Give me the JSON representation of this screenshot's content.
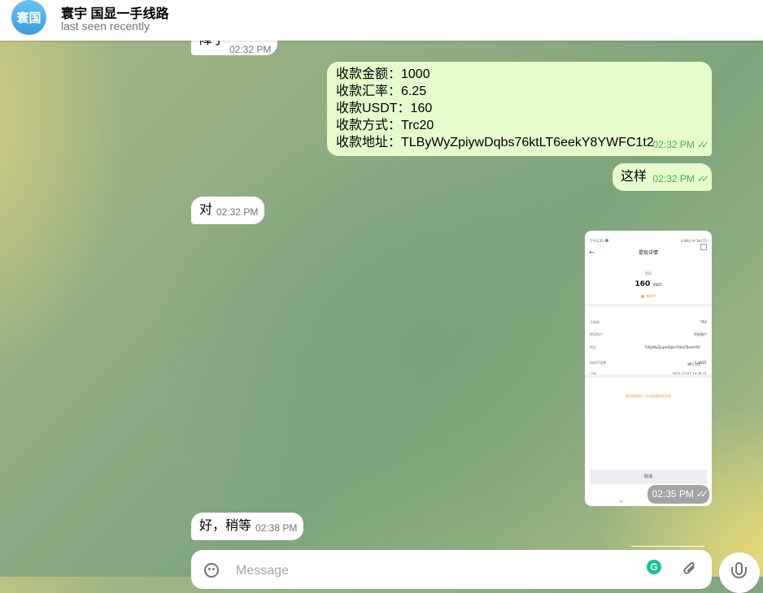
{
  "header": {
    "avatar_text": "寰国",
    "title": "寰宇 国显一手线路",
    "subtitle": "last seen recently"
  },
  "messages": {
    "top_partial": {
      "text": "障了",
      "time": "02:32 PM"
    },
    "payment": {
      "lines": [
        "收款金额：1000",
        "收款汇率：6.25",
        "收款USDT：160",
        "收款方式：Trc20",
        "收款地址：TLByWyZpiywDqbs76ktLT6eekY8YWFC1t2"
      ],
      "time": "02:32 PM",
      "ticks": "✓✓"
    },
    "zheyang": {
      "text": "这样",
      "time": "02:32 PM",
      "ticks": "✓✓"
    },
    "dui": {
      "text": "对",
      "time": "02:32 PM"
    },
    "image": {
      "time": "02:35 PM",
      "ticks": "✓✓",
      "screenshot": {
        "status_left": "下午2:35",
        "status_right": "4.9K/s 中 Tull 75",
        "title": "提现详情",
        "category": "提现",
        "amount": "160",
        "unit": "USDT",
        "status": "审核中",
        "rows": [
          {
            "label": "主网络",
            "value": "TRX"
          },
          {
            "label": "提现账户",
            "value": "资金账户"
          },
          {
            "label": "地址",
            "value": "TLByWyZpiywDqbs76ktLT6eekY8YWFC1t2"
          },
          {
            "label": "网络手续费",
            "value": "1 USDT"
          },
          {
            "label": "日期",
            "value": "2021-12-07 14:35:11"
          }
        ],
        "help_link": "提现需帮助？点击查看帮助文档",
        "cancel_button": "取消"
      }
    },
    "hao": {
      "text": "好，稍等",
      "time": "02:38 PM"
    }
  },
  "composer": {
    "placeholder": "Message",
    "emoji_icon": "smile-icon",
    "grammarly_letter": "G",
    "attach_icon": "paperclip-icon",
    "mic_icon": "microphone-icon"
  }
}
